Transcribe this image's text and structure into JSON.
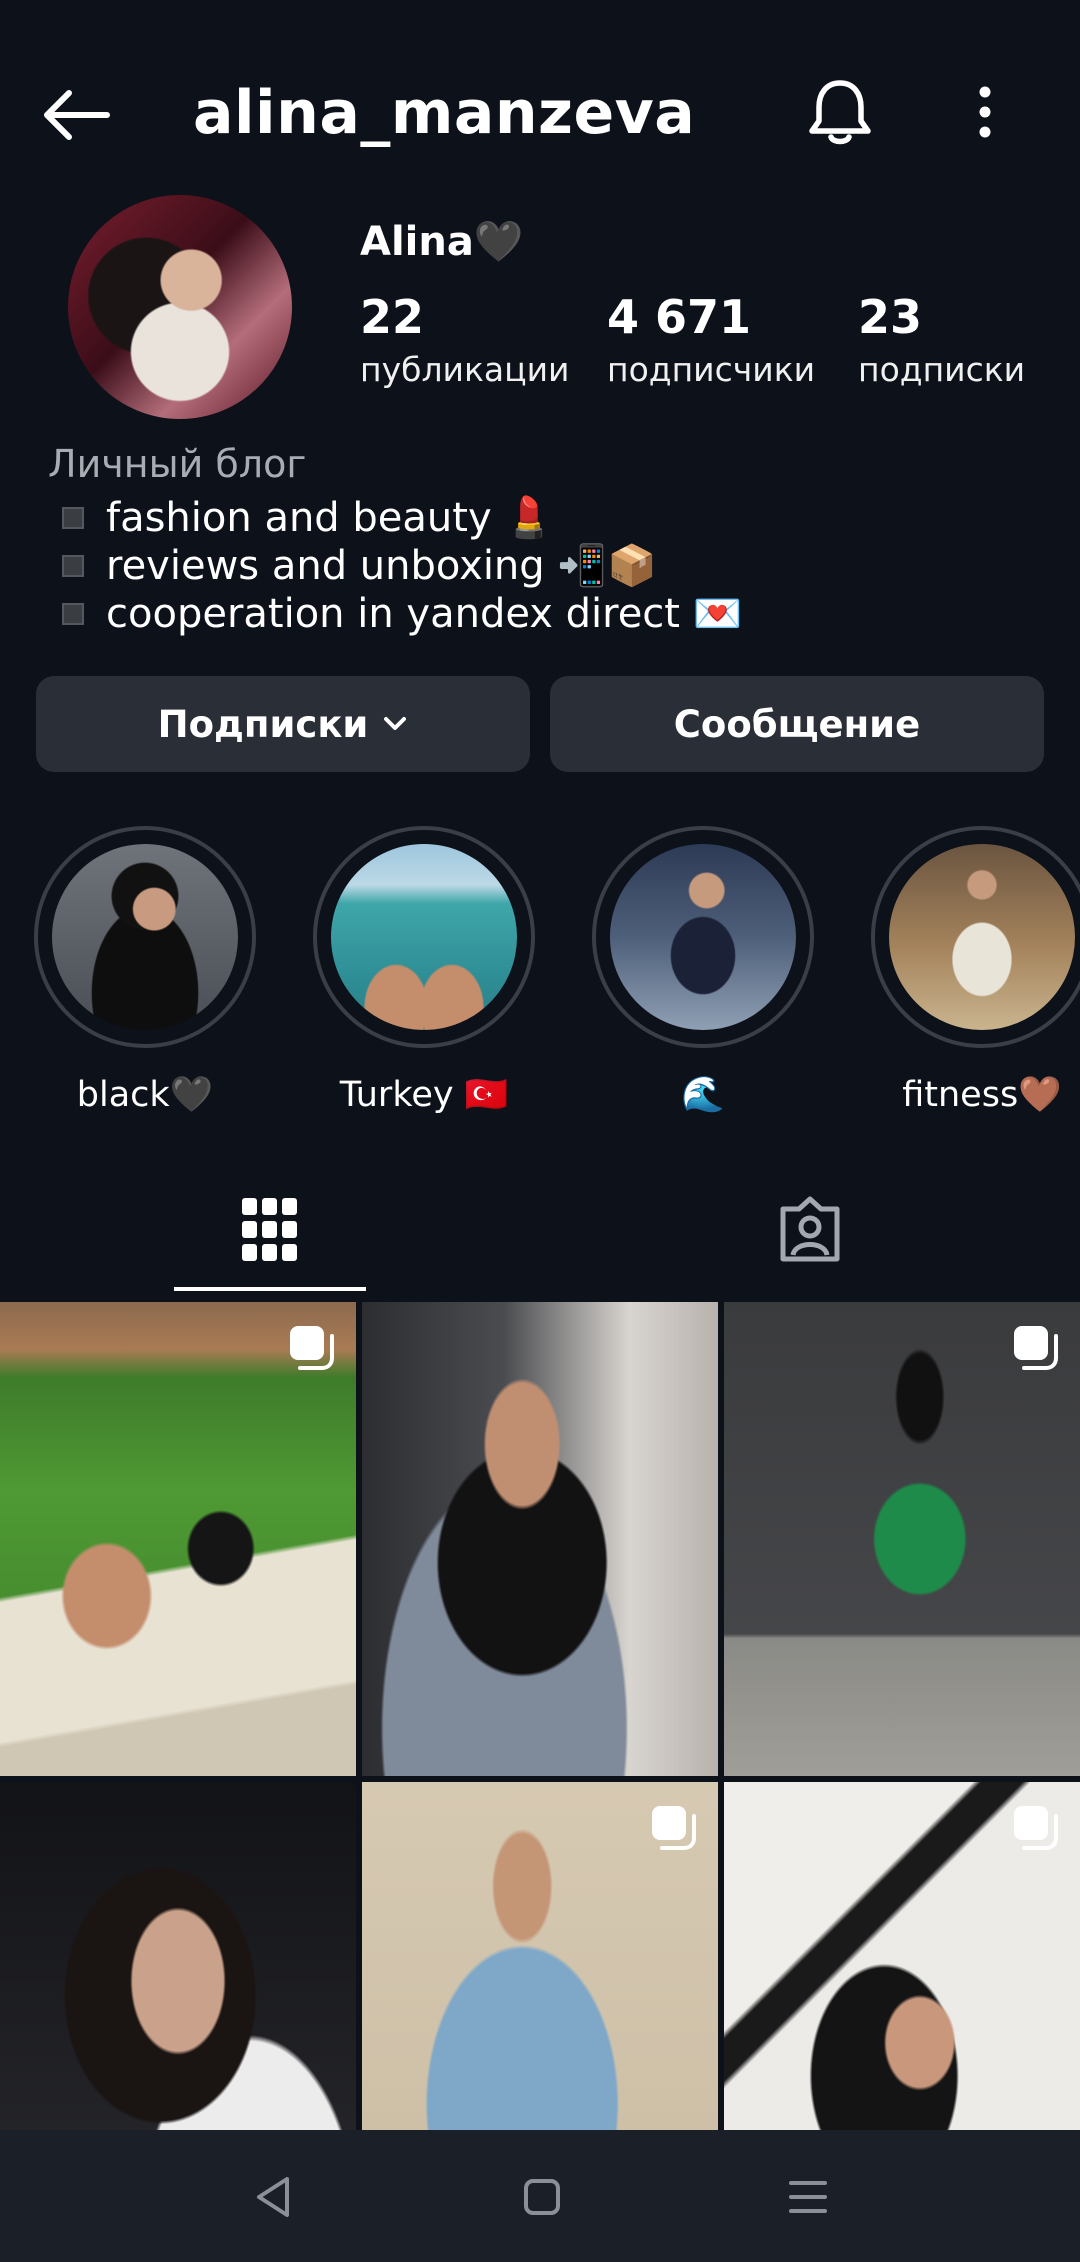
{
  "header": {
    "username": "alina_manzeva"
  },
  "profile": {
    "display_name": "Alina🖤",
    "stats": [
      {
        "value": "22",
        "label": "публикации"
      },
      {
        "value": "4 671",
        "label": "подписчики"
      },
      {
        "value": "23",
        "label": "подписки"
      }
    ],
    "category": "Личный блог",
    "bio": [
      "fashion and beauty 💄",
      "reviews and unboxing 📲📦",
      "cooperation in yandex direct 💌"
    ]
  },
  "actions": {
    "following_label": "Подписки",
    "message_label": "Сообщение"
  },
  "highlights": [
    {
      "label": "black🖤"
    },
    {
      "label": "Turkey 🇹🇷"
    },
    {
      "label": "🌊"
    },
    {
      "label": "fitness🤎"
    }
  ],
  "tabs": [
    {
      "icon": "grid-icon",
      "active": true
    },
    {
      "icon": "tagged-person-icon",
      "active": false
    }
  ],
  "posts": [
    {
      "multi": true
    },
    {
      "multi": false
    },
    {
      "multi": true
    },
    {
      "multi": false
    },
    {
      "multi": true
    },
    {
      "multi": true
    }
  ],
  "nav": [
    "back-triangle-icon",
    "home-square-icon",
    "menu-lines-icon"
  ]
}
